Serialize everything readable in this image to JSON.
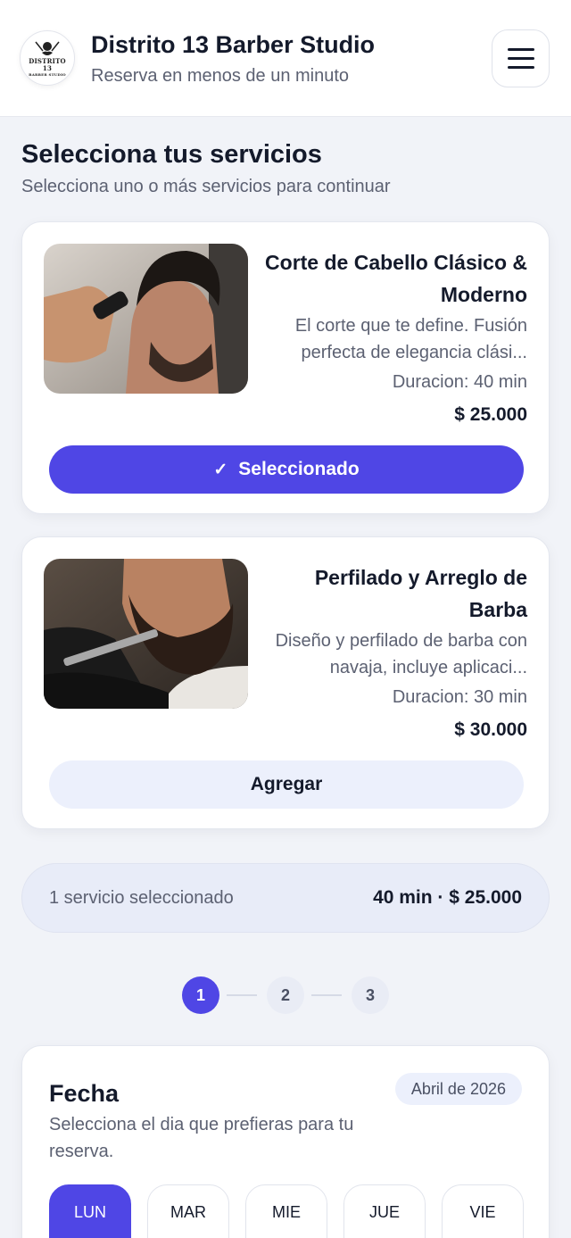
{
  "header": {
    "logo_text": "DISTRITO 13",
    "logo_subtext": "BARBER STUDIO",
    "title": "Distrito 13 Barber Studio",
    "subtitle": "Reserva en menos de un minuto",
    "menu_icon": "hamburger-menu-icon"
  },
  "services_section": {
    "title": "Selecciona tus servicios",
    "subtitle": "Selecciona uno o más servicios para continuar"
  },
  "services": [
    {
      "name": "Corte de Cabello Clásico & Moderno",
      "description": "El corte que te define. Fusión perfecta de elegancia clási...",
      "duration": "Duracion: 40 min",
      "price": "$ 25.000",
      "button_label": "Seleccionado",
      "button_icon": "check-icon",
      "selected": true
    },
    {
      "name": "Perfilado y Arreglo de Barba",
      "description": "Diseño y perfilado de barba con navaja, incluye aplicaci...",
      "duration": "Duracion: 30 min",
      "price": "$ 30.000",
      "button_label": "Agregar",
      "selected": false
    }
  ],
  "summary": {
    "count_text": "1 servicio seleccionado",
    "totals_text": "40 min · $ 25.000"
  },
  "steps": [
    "1",
    "2",
    "3"
  ],
  "active_step": "1",
  "date_section": {
    "title": "Fecha",
    "month": "Abril de 2026",
    "subtitle": "Selecciona el dia que prefieras para tu reserva.",
    "days": [
      "LUN",
      "MAR",
      "MIE",
      "JUE",
      "VIE"
    ],
    "active_day": "LUN"
  },
  "colors": {
    "accent": "#4f46e5",
    "background": "#f1f3f8",
    "card": "#ffffff",
    "text": "#141a2b",
    "muted": "#5c6172",
    "soft_accent": "#ecf0fc"
  }
}
